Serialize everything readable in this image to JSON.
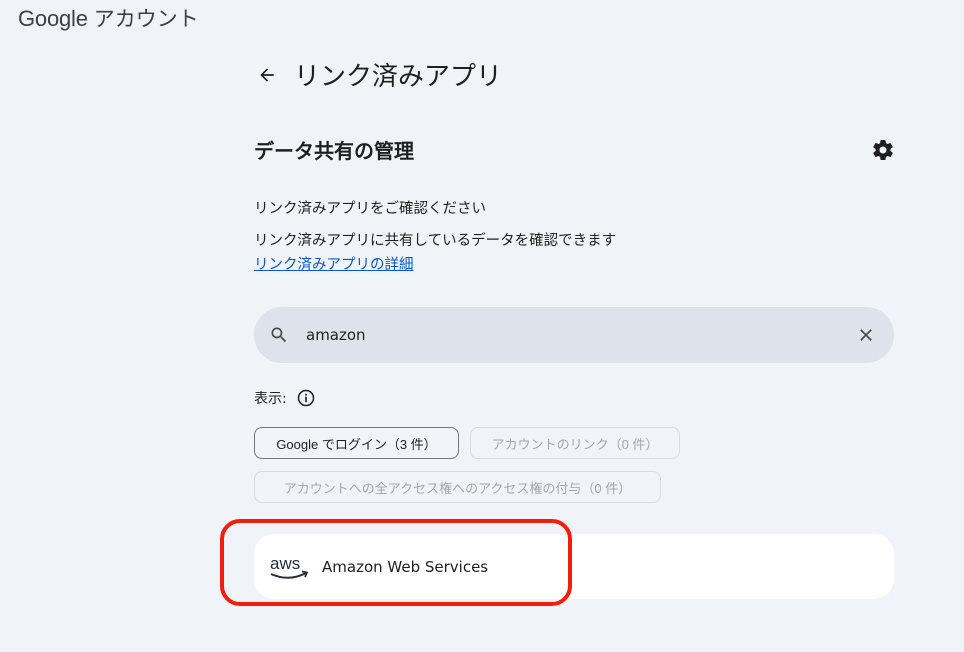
{
  "brand": {
    "google": "Google",
    "account": "アカウント"
  },
  "header": {
    "title": "リンク済みアプリ"
  },
  "section": {
    "title": "データ共有の管理"
  },
  "description": {
    "line1": "リンク済みアプリをご確認ください",
    "line2": "リンク済みアプリに共有しているデータを確認できます",
    "link": "リンク済みアプリの詳細"
  },
  "search": {
    "value": "amazon"
  },
  "filter": {
    "label": "表示:",
    "chips": [
      {
        "label": "Google でログイン（3 件）",
        "state": "active"
      },
      {
        "label": "アカウントのリンク（0 件）",
        "state": "disabled"
      },
      {
        "label": "アカウントへの全アクセス権へのアクセス権の付与（0 件）",
        "state": "disabled"
      }
    ]
  },
  "apps": [
    {
      "name": "Amazon Web Services",
      "logo": "aws-logo",
      "logo_text": "aws"
    }
  ],
  "colors": {
    "background": "#f0f4f9",
    "search_bg": "#dde3ea",
    "link": "#0b57d0",
    "highlight": "#f21d0d",
    "aws_orange": "#ff9900"
  }
}
